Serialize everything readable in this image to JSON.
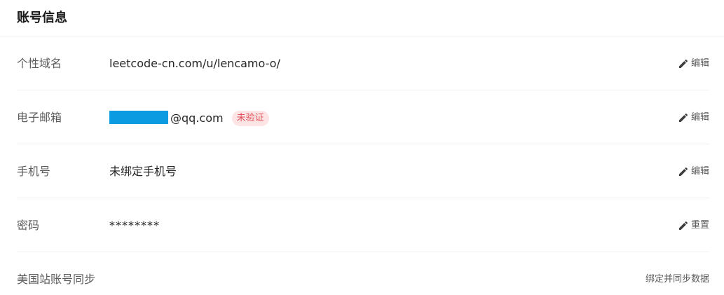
{
  "section": {
    "title": "账号信息"
  },
  "rows": [
    {
      "label": "个性域名",
      "value": "leetcode-cn.com/u/lencamo-o/",
      "action": "编辑",
      "action_icon": "pencil-icon"
    },
    {
      "label": "电子邮箱",
      "value": "@qq.com",
      "badge": "未验证",
      "action": "编辑",
      "action_icon": "pencil-icon"
    },
    {
      "label": "手机号",
      "value": "未绑定手机号",
      "action": "编辑",
      "action_icon": "pencil-icon"
    },
    {
      "label": "密码",
      "value": "********",
      "action": "重置",
      "action_icon": "pencil-icon"
    },
    {
      "label": "美国站账号同步",
      "action": "绑定并同步数据"
    }
  ],
  "colors": {
    "redaction": "#0b9be0",
    "badge_text": "#e0505a",
    "badge_bg": "#fde5e6"
  }
}
